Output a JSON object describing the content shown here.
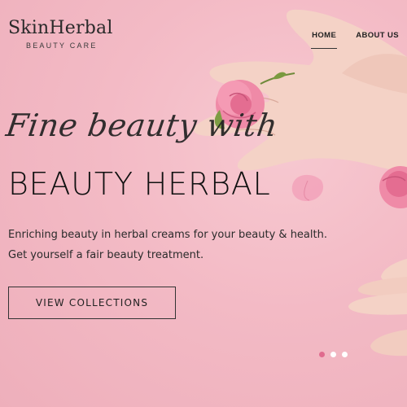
{
  "brand": {
    "name": "SkinHerbal",
    "tagline": "BEAUTY CARE"
  },
  "nav": {
    "items": [
      {
        "label": "HOME",
        "active": true
      },
      {
        "label": "ABOUT US",
        "active": false
      }
    ]
  },
  "hero": {
    "script_text": "Fine beauty with",
    "headline": "BEAUTY HERBAL",
    "description_line1": "Enriching beauty in herbal creams for your beauty & health.",
    "description_line2": "Get yourself a fair beauty treatment.",
    "cta_label": "VIEW COLLECTIONS"
  },
  "slider": {
    "dot_count": 3,
    "active_index": 0
  },
  "colors": {
    "background": "#f3bac5",
    "accent_dot": "#e06b8e",
    "text": "#222222"
  }
}
